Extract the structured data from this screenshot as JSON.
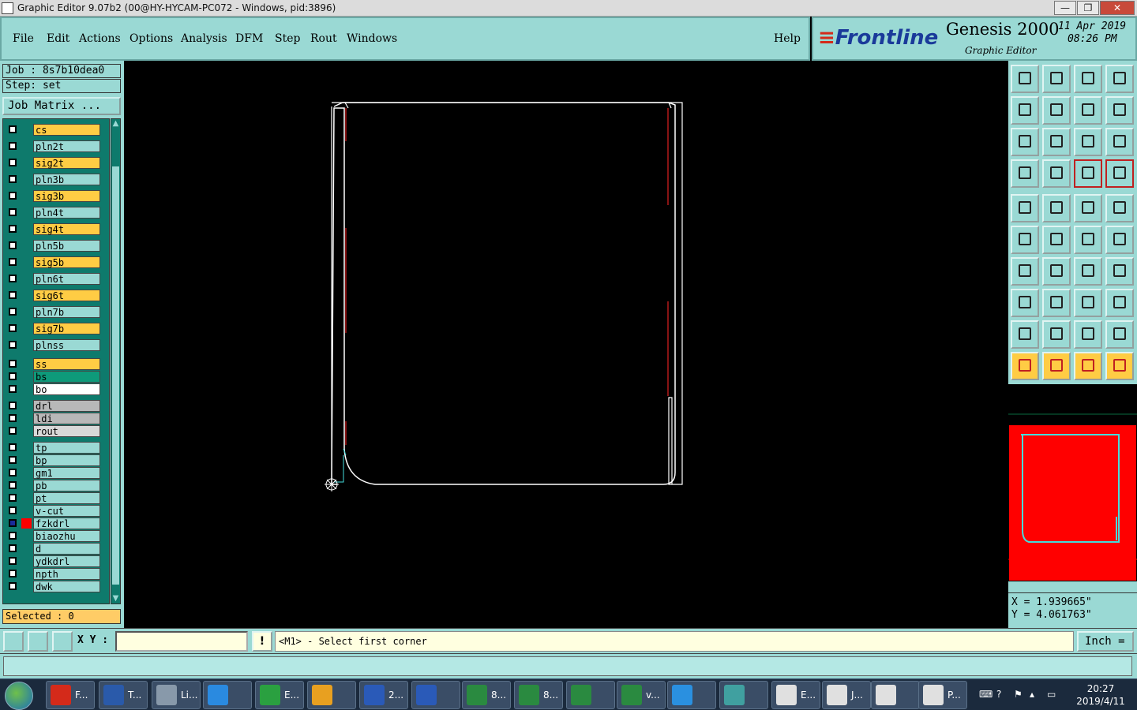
{
  "window": {
    "title": "Graphic Editor 9.07b2 (00@HY-HYCAM-PC072 - Windows, pid:3896)",
    "controls": {
      "minimize": "—",
      "maximize": "❐",
      "close": "✕"
    }
  },
  "menu": {
    "items": [
      "File",
      "Edit",
      "Actions",
      "Options",
      "Analysis",
      "DFM",
      "Step",
      "Rout",
      "Windows"
    ],
    "help": "Help"
  },
  "header": {
    "logo": "Frontline",
    "product": "Genesis 2000",
    "subtitle": "Graphic Editor",
    "date": "11 Apr 2019",
    "time": "08:26 PM"
  },
  "job": {
    "job_line": "Job : 8s7b10dea0",
    "step_line": "Step: set",
    "matrix_button": "Job Matrix ..."
  },
  "layers": [
    {
      "name": "cs",
      "color": "#ffcc44"
    },
    {
      "name": "pln2t",
      "color": "#9ad9d4"
    },
    {
      "name": "sig2t",
      "color": "#ffcc44"
    },
    {
      "name": "pln3b",
      "color": "#9ad9d4"
    },
    {
      "name": "sig3b",
      "color": "#ffcc44"
    },
    {
      "name": "pln4t",
      "color": "#9ad9d4"
    },
    {
      "name": "sig4t",
      "color": "#ffcc44"
    },
    {
      "name": "pln5b",
      "color": "#9ad9d4"
    },
    {
      "name": "sig5b",
      "color": "#ffcc44"
    },
    {
      "name": "pln6t",
      "color": "#9ad9d4"
    },
    {
      "name": "sig6t",
      "color": "#ffcc44"
    },
    {
      "name": "pln7b",
      "color": "#9ad9d4"
    },
    {
      "name": "sig7b",
      "color": "#ffcc44"
    },
    {
      "name": "plnss",
      "color": "#9ad9d4"
    },
    {
      "name": "ss",
      "color": "#ffcc44"
    },
    {
      "name": "bs",
      "color": "#0e9a7a"
    },
    {
      "name": "bo",
      "color": "#ffffff"
    },
    {
      "name": "drl",
      "color": "#b8b8b8"
    },
    {
      "name": "ldi",
      "color": "#b8b8b8"
    },
    {
      "name": "rout",
      "color": "#d8d8d8"
    },
    {
      "name": "tp",
      "color": "#9ad9d4"
    },
    {
      "name": "bp",
      "color": "#9ad9d4"
    },
    {
      "name": "gm1",
      "color": "#9ad9d4"
    },
    {
      "name": "pb",
      "color": "#9ad9d4"
    },
    {
      "name": "pt",
      "color": "#9ad9d4"
    },
    {
      "name": "v-cut",
      "color": "#9ad9d4"
    },
    {
      "name": "fzkdrl",
      "color": "#9ad9d4",
      "active": true
    },
    {
      "name": "biaozhu",
      "color": "#9ad9d4"
    },
    {
      "name": "d",
      "color": "#9ad9d4"
    },
    {
      "name": "ydkdrl",
      "color": "#9ad9d4"
    },
    {
      "name": "npth",
      "color": "#9ad9d4"
    },
    {
      "name": "dwk",
      "color": "#9ad9d4"
    }
  ],
  "selected": "Selected : 0",
  "coords": {
    "x": "X = 1.939665\"",
    "y": "Y = 4.061763\""
  },
  "command": {
    "xy_label": "X Y :",
    "xy_value": "",
    "exclaim": "!",
    "prompt": "<M1> - Select first corner",
    "units": "Inch ="
  },
  "taskbar": {
    "tasks": [
      {
        "label": "F...",
        "icon": "genesis-icon",
        "color": "#d42a1a"
      },
      {
        "label": "T...",
        "icon": "floppy-icon",
        "color": "#2a5aaa"
      },
      {
        "label": "Li...",
        "icon": "scanner-icon",
        "color": "#8899aa"
      },
      {
        "label": "",
        "icon": "ie-icon",
        "color": "#2a8ae0"
      },
      {
        "label": "E...",
        "icon": "frontline-icon",
        "color": "#2aa040"
      },
      {
        "label": "",
        "icon": "shell-icon",
        "color": "#e8a020"
      },
      {
        "label": "2...",
        "icon": "word-icon",
        "color": "#2a5ab8"
      },
      {
        "label": "",
        "icon": "word-icon",
        "color": "#2a5ab8"
      },
      {
        "label": "8...",
        "icon": "excel-icon",
        "color": "#2a8a40"
      },
      {
        "label": "8...",
        "icon": "excel-icon",
        "color": "#2a8a40"
      },
      {
        "label": "",
        "icon": "excel-icon",
        "color": "#2a8a40"
      },
      {
        "label": "v...",
        "icon": "excel-icon",
        "color": "#2a8a40"
      },
      {
        "label": "",
        "icon": "bird-icon",
        "color": "#2a90e0"
      },
      {
        "label": "",
        "icon": "eye-icon",
        "color": "#40a0a0"
      },
      {
        "label": "E...",
        "icon": "graphic-editor-icon",
        "color": "#e0e0e0"
      },
      {
        "label": "J...",
        "icon": "graphic-editor-icon",
        "color": "#e0e0e0"
      },
      {
        "label": "",
        "icon": "graphic-editor-icon",
        "color": "#e0e0e0"
      },
      {
        "label": "P...",
        "icon": "graphic-editor-icon",
        "color": "#e0e0e0"
      }
    ],
    "clock_time": "20:27",
    "clock_date": "2019/4/11"
  },
  "colors": {
    "panel": "#9ad9d4",
    "layer_bg": "#0e7a6c",
    "board_outline": "#ffffff",
    "red_marks": "#e02020",
    "cyan_marks": "#44dddd"
  }
}
